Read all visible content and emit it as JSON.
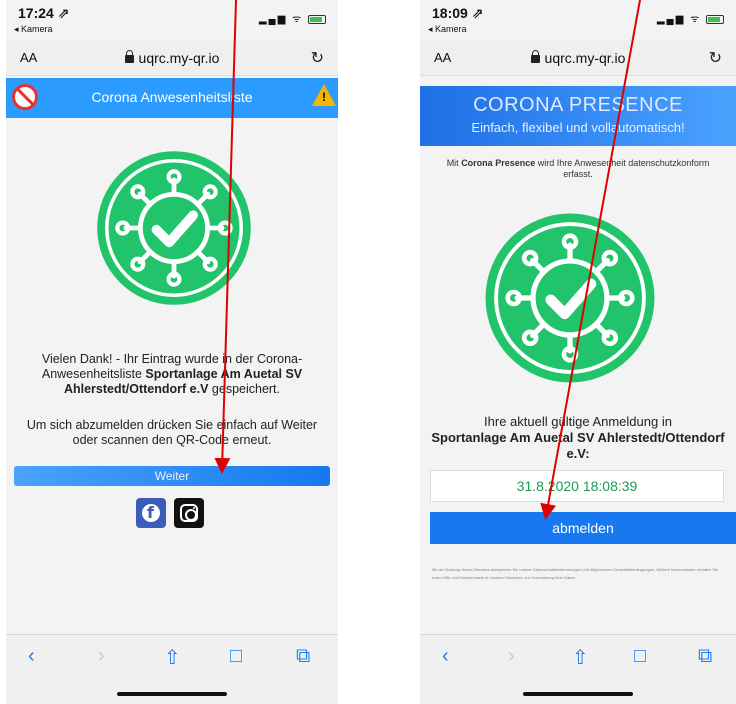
{
  "left": {
    "status": {
      "time": "17:24 ⇗",
      "back_app": "◂ Kamera",
      "signal": "▂▄▆ ᯤ"
    },
    "url": {
      "aa": "AA",
      "domain": "uqrc.my-qr.io",
      "reload_glyph": "↻"
    },
    "header_title": "Corona Anwesenheitsliste",
    "message": {
      "part1": "Vielen Dank! - Ihr Eintrag wurde in der Corona-Anwesenheitsliste ",
      "venue": "Sportanlage Am Auetal SV Ahlerstedt/Ottendorf e.V",
      "part2": " gespeichert."
    },
    "logout_hint": "Um sich abzumelden drücken Sie einfach auf Weiter oder scannen den QR-Code erneut.",
    "weiter_label": "Weiter"
  },
  "right": {
    "status": {
      "time": "18:09 ⇗",
      "back_app": "◂ Kamera",
      "signal": "▂▄▆ ᯤ"
    },
    "url": {
      "aa": "AA",
      "domain": "uqrc.my-qr.io",
      "reload_glyph": "↻"
    },
    "brand_title": "CORONA PRESENCE",
    "brand_subtitle": "Einfach, flexibel und vollautomatisch!",
    "intro": {
      "part1": "Mit ",
      "brand": "Corona Presence",
      "part2": " wird Ihre Anwesenheit datenschutzkonform erfasst."
    },
    "registration": {
      "label": "Ihre aktuell gültige Anmeldung in",
      "venue": "Sportanlage Am Auetal SV Ahlerstedt/Ottendorf e.V:",
      "datetime": "31.8.2020 18:08:39"
    },
    "abmelden_label": "abmelden",
    "fine_print": "Mit der Nutzung dieses Dienstes akzeptieren Sie unsere Datenschutzbestimmungen und Allgemeinen Geschäftsbedingungen. Weitere Informationen erhalten Sie unter Hilfe und Kontakt sowie in unseren Hinweisen zur Verarbeitung Ihrer Daten."
  },
  "toolbar": {
    "back": "‹",
    "forward": "›",
    "share": "⇧",
    "bookmarks": "□",
    "tabs": "⧉"
  },
  "colors": {
    "accent": "#1778ef",
    "virus_green": "#21c46b",
    "arrow": "#e00000"
  }
}
